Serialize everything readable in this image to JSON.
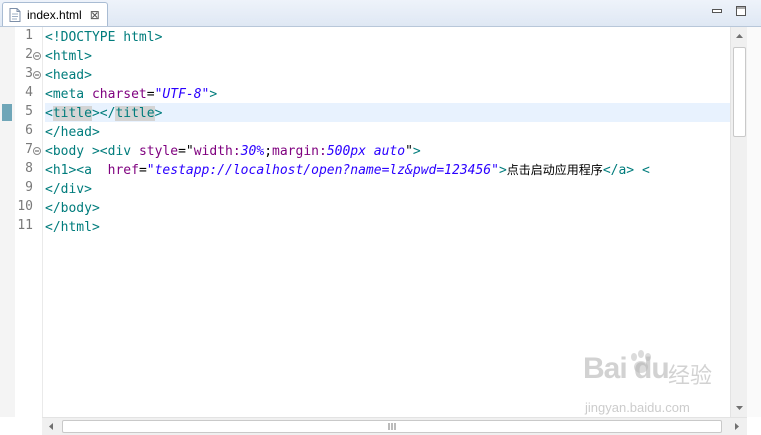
{
  "tab": {
    "title": "index.html",
    "close_glyph": "⊠"
  },
  "line_numbers": [
    "1",
    "2",
    "3",
    "4",
    "5",
    "6",
    "7",
    "8",
    "9",
    "10",
    "11"
  ],
  "code": {
    "l1": {
      "tag": "<!DOCTYPE html>"
    },
    "l2": {
      "tag": "<html>"
    },
    "l3": {
      "tag": "<head>"
    },
    "l4": {
      "tag_open": "<meta ",
      "attr": "charset",
      "eq": "=",
      "value": "\"UTF-8\"",
      "tag_close": ">"
    },
    "l5": {
      "open": "<",
      "open_name": "title",
      "mid": "></",
      "close_name": "title",
      "end": ">"
    },
    "l6": {
      "tag": "</head>"
    },
    "l7": {
      "body_tag": "<body ",
      "body_close": ">",
      "div_tag": "<div ",
      "attr": "style",
      "eq": "=",
      "q1": "\"",
      "p1": "width:",
      "v1": "30%",
      "semi": ";",
      "p2": "margin:",
      "v2": "500px auto",
      "q2": "\"",
      "div_close": ">"
    },
    "l8": {
      "tag1": "<h1><a  ",
      "attr": "href",
      "eq": "=",
      "value": "\"testapp://localhost/open?name=lz&pwd=123456\"",
      "gt": ">",
      "text": "点击启动应用程序",
      "tag2": "</a> <"
    },
    "l9": {
      "tag": "</div>"
    },
    "l10": {
      "tag": "</body>"
    },
    "l11": {
      "tag": "</html>"
    }
  },
  "watermark": {
    "brand": "Bai du",
    "brand_cn": "经验",
    "url": "jingyan.baidu.com"
  },
  "icons": {
    "file": "html-file-icon",
    "close": "close-icon",
    "minimize": "minimize-icon",
    "maximize": "maximize-icon"
  },
  "colors": {
    "tag": "#007c7c",
    "attribute": "#7f007f",
    "string": "#2a00ff",
    "current_line": "#e8f2fe"
  }
}
